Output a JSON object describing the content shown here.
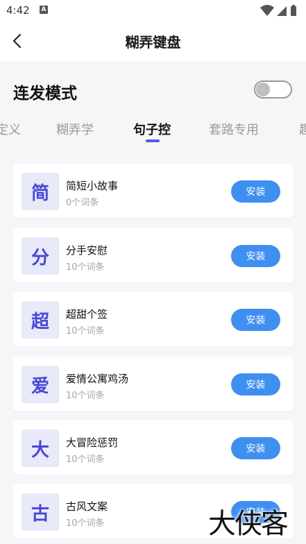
{
  "status": {
    "time": "4:42",
    "app_icon": "A"
  },
  "header": {
    "title": "糊弄键盘",
    "back_icon": "chevron-left-icon"
  },
  "mode": {
    "label": "连发模式",
    "enabled": false
  },
  "tabs": [
    {
      "label": "定义",
      "active": false
    },
    {
      "label": "糊弄学",
      "active": false
    },
    {
      "label": "句子控",
      "active": true
    },
    {
      "label": "套路专用",
      "active": false
    },
    {
      "label": "趣",
      "active": false
    }
  ],
  "items": [
    {
      "icon_char": "简",
      "title": "简短小故事",
      "count": "0个词条",
      "button": "安装"
    },
    {
      "icon_char": "分",
      "title": "分手安慰",
      "count": "10个词条",
      "button": "安装"
    },
    {
      "icon_char": "超",
      "title": "超甜个签",
      "count": "10个词条",
      "button": "安装"
    },
    {
      "icon_char": "爱",
      "title": "爱情公寓鸡汤",
      "count": "10个词条",
      "button": "安装"
    },
    {
      "icon_char": "大",
      "title": "大冒险惩罚",
      "count": "10个词条",
      "button": "安装"
    },
    {
      "icon_char": "古",
      "title": "古风文案",
      "count": "10个词条",
      "button": "安装"
    }
  ],
  "watermark": "大侠客",
  "colors": {
    "accent": "#5a55e6",
    "button": "#3f8ff0",
    "icon_bg": "#e8e9f9",
    "icon_text": "#4b47d6"
  }
}
